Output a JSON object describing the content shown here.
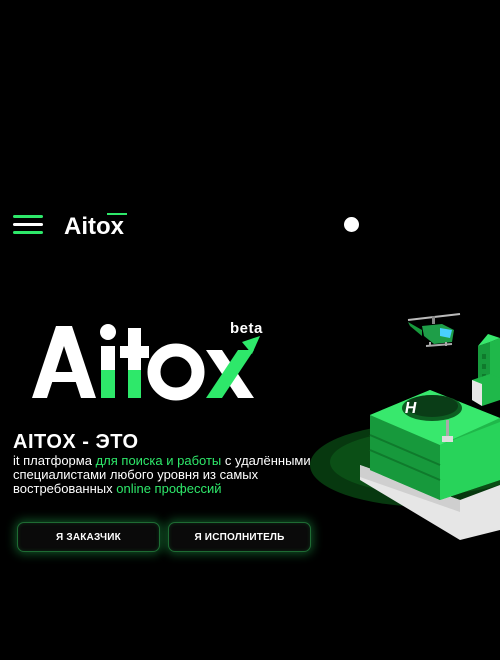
{
  "header": {
    "brand": "Aitox",
    "menu_icon": "hamburger-menu-icon",
    "indicator_icon": "dot-icon"
  },
  "hero": {
    "logo_text": "Aitox",
    "badge": "beta",
    "title": "AITOX - ЭТО",
    "desc_part1": "it платформа ",
    "desc_highlight1": "для поиска и работы",
    "desc_part2": " с удалёнными специалистами любого уровня из самых востребованных ",
    "desc_highlight2": "online профессий"
  },
  "buttons": {
    "client_label": "Я ЗАКАЗЧИК",
    "freelancer_label": "Я ИСПОЛНИТЕЛЬ"
  },
  "illustration": {
    "icon": "isometric-city-helipad-illustration"
  },
  "colors": {
    "accent": "#2ee86a",
    "background": "#000000",
    "text": "#ffffff"
  }
}
